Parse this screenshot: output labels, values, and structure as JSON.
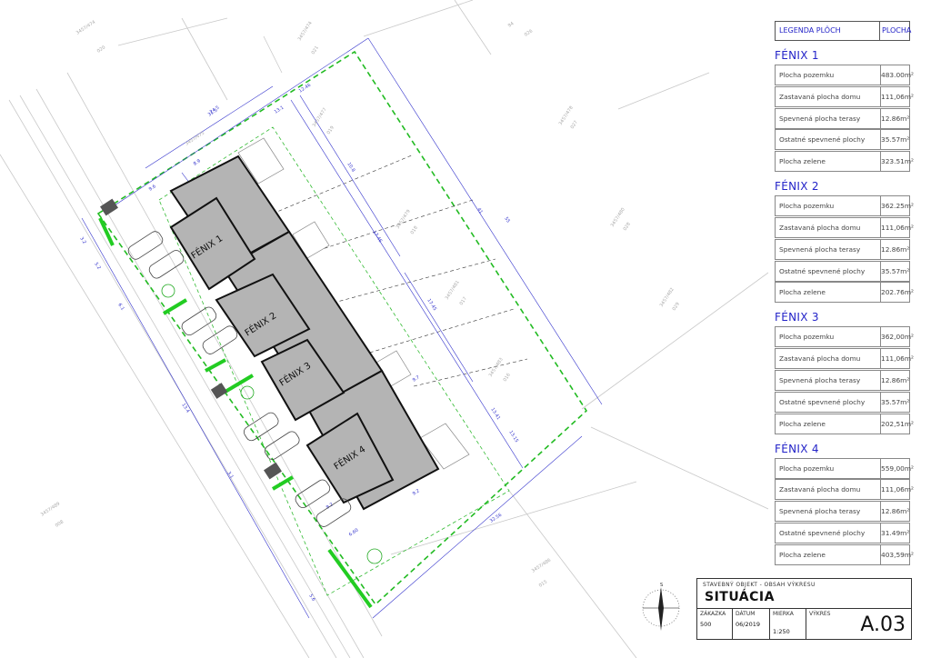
{
  "plan": {
    "buildings": [
      {
        "label": "FÉNIX 1"
      },
      {
        "label": "FÉNIX 2"
      },
      {
        "label": "FÉNIX 3"
      },
      {
        "label": "FÉNIX 4"
      }
    ],
    "parcels": [
      {
        "id": "3457/477",
        "no": "019"
      },
      {
        "id": "3457/479",
        "no": "018"
      },
      {
        "id": "3457/481",
        "no": "017"
      },
      {
        "id": "3457/483",
        "no": "016"
      },
      {
        "id": "3457/478",
        "no": "027"
      },
      {
        "id": "3457/480",
        "no": "028"
      },
      {
        "id": "3457/482",
        "no": "029"
      },
      {
        "id": "3457/486",
        "no": "015"
      },
      {
        "id": "3457/489",
        "no": "008"
      },
      {
        "id": "3457/474",
        "no": "020"
      },
      {
        "id": "3457/474",
        "no": "021"
      },
      {
        "id": "3457/475",
        "no": ""
      },
      {
        "id": "94",
        "no": "026"
      }
    ],
    "dims_outer": [
      "31.5",
      "41",
      "12.46",
      "8.9",
      "9.6",
      "55",
      "13.41",
      "32.56",
      "24.5"
    ],
    "dims_inner": [
      "10.8",
      "17.45",
      "13.15",
      "17.46",
      "9.7",
      "13.1"
    ],
    "dims_left": [
      "3.2",
      "5.2",
      "6.1",
      "13.4",
      "3.1",
      "5.6"
    ],
    "dims_front": [
      "9.2",
      "9.2",
      "6.60"
    ]
  },
  "legend": {
    "header_label": "LEGENDA PLÔCH",
    "header_value": "PLOCHA",
    "sections": [
      {
        "title": "FÉNIX 1",
        "rows": [
          {
            "label": "Plocha pozemku",
            "value": "483.00m²"
          },
          {
            "label": "Zastavaná plocha domu",
            "value": "111,06m²"
          },
          {
            "label": "Spevnená plocha terasy",
            "value": "12.86m²"
          },
          {
            "label": "Ostatné spevnené plochy",
            "value": "35.57m²"
          },
          {
            "label": "Plocha zelene",
            "value": "323.51m²"
          }
        ]
      },
      {
        "title": "FÉNIX 2",
        "rows": [
          {
            "label": "Plocha pozemku",
            "value": "362.25m²"
          },
          {
            "label": "Zastavaná plocha domu",
            "value": "111,06m²"
          },
          {
            "label": "Spevnená plocha terasy",
            "value": "12.86m²"
          },
          {
            "label": "Ostatné spevnené plochy",
            "value": "35.57m²"
          },
          {
            "label": "Plocha zelene",
            "value": "202.76m²"
          }
        ]
      },
      {
        "title": "FÉNIX 3",
        "rows": [
          {
            "label": "Plocha pozemku",
            "value": "362,00m²"
          },
          {
            "label": "Zastavaná plocha domu",
            "value": "111,06m²"
          },
          {
            "label": "Spevnená plocha terasy",
            "value": "12.86m²"
          },
          {
            "label": "Ostatné spevnené plochy",
            "value": "35.57m²"
          },
          {
            "label": "Plocha zelene",
            "value": "202,51m²"
          }
        ]
      },
      {
        "title": "FÉNIX 4",
        "rows": [
          {
            "label": "Plocha pozemku",
            "value": "559,00m²"
          },
          {
            "label": "Zastavaná plocha domu",
            "value": "111,06m²"
          },
          {
            "label": "Spevnená plocha terasy",
            "value": "12.86m²"
          },
          {
            "label": "Ostatné spevnené plochy",
            "value": "31.49m²"
          },
          {
            "label": "Plocha zelene",
            "value": "403,59m²"
          }
        ]
      }
    ]
  },
  "titleblock": {
    "subtitle": "STAVEBNÝ OBJEKT - OBSAH VÝKRESU",
    "title": "SITUÁCIA",
    "order_label": "ZÁKAZKA",
    "order_value": "500",
    "date_label": "DÁTUM",
    "date_value": "06/2019",
    "scale_label": "MIERKA",
    "scale_value": "1:250",
    "drawing_label": "VÝKRES",
    "sheet": "A.03"
  },
  "compass_label": "S",
  "colors": {
    "boundary": "#22bb22",
    "dimension": "#3333cc",
    "building": "#b4b4b4",
    "green": "#22cc22"
  }
}
